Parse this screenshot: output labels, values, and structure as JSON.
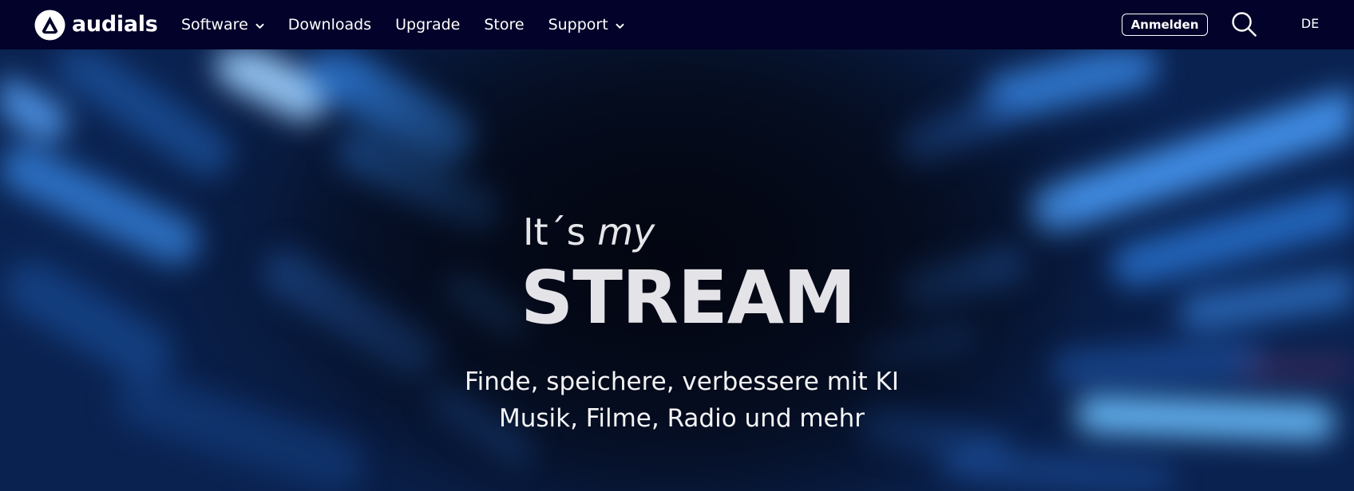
{
  "brand": {
    "name": "audials",
    "logo_icon": "audials-logo-icon"
  },
  "nav": {
    "items": [
      {
        "label": "Software",
        "has_dropdown": true
      },
      {
        "label": "Downloads",
        "has_dropdown": false
      },
      {
        "label": "Upgrade",
        "has_dropdown": false
      },
      {
        "label": "Store",
        "has_dropdown": false
      },
      {
        "label": "Support",
        "has_dropdown": true
      }
    ],
    "login_label": "Anmelden",
    "search_icon": "search-icon",
    "language": "DE"
  },
  "hero": {
    "tagline_prefix": "It´s ",
    "tagline_emphasis": "my",
    "headline": "STREAM",
    "subline_1": "Finde, speichere, verbessere mit KI",
    "subline_2": "Musik, Filme, Radio und mehr"
  },
  "colors": {
    "nav_background": "#02022a",
    "hero_accent": "#2e8cff",
    "text": "#ffffff"
  }
}
